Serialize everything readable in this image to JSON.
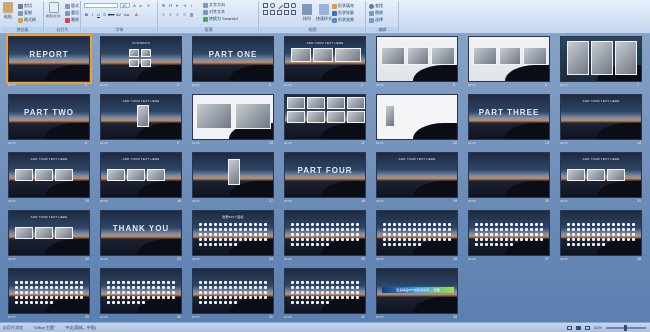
{
  "ribbon": {
    "groups": [
      {
        "label": "剪贴板"
      },
      {
        "label": "幻灯片"
      },
      {
        "label": "字体"
      },
      {
        "label": "段落"
      },
      {
        "label": "绘图"
      },
      {
        "label": "编辑"
      }
    ],
    "clipboard": {
      "paste": "粘贴",
      "cut": "剪切",
      "copy": "复制",
      "format_painter": "格式刷"
    },
    "slides": {
      "new_slide": "新建幻灯片",
      "layout": "版式",
      "reset": "重设",
      "delete": "删除"
    },
    "font": {
      "font_name": "",
      "font_size": "10"
    },
    "paragraph": {
      "text_direction": "文字方向",
      "align_text": "对齐文本",
      "convert_smartart": "转换为 SmartArt"
    },
    "drawing": {
      "arrange": "排列",
      "quick_styles": "快速样式",
      "shape_fill": "形状填充",
      "shape_outline": "形状轮廓",
      "shape_effects": "形状效果"
    },
    "editing": {
      "find": "查找",
      "replace": "替换",
      "select": "选择"
    }
  },
  "slides": [
    {
      "n": "1",
      "title": "",
      "big": "REPORT",
      "kind": "title"
    },
    {
      "n": "2",
      "title": "CONTENTS",
      "big": "",
      "kind": "contents"
    },
    {
      "n": "3",
      "title": "",
      "big": "PART ONE",
      "kind": "part"
    },
    {
      "n": "4",
      "title": "ADD YOUR TEXT HERE",
      "big": "",
      "kind": "photos"
    },
    {
      "n": "5",
      "title": "ADD YOUR TEXT HERE",
      "big": "",
      "kind": "photos-light"
    },
    {
      "n": "6",
      "title": "",
      "big": "",
      "kind": "photos-light"
    },
    {
      "n": "7",
      "title": "",
      "big": "",
      "kind": "photos-people"
    },
    {
      "n": "8",
      "title": "",
      "big": "PART TWO",
      "kind": "part"
    },
    {
      "n": "9",
      "title": "ADD YOUR TEXT HERE",
      "big": "",
      "kind": "phone"
    },
    {
      "n": "10",
      "title": "",
      "big": "",
      "kind": "photos-wide"
    },
    {
      "n": "11",
      "title": "",
      "big": "",
      "kind": "collage"
    },
    {
      "n": "12",
      "title": "App Project Sample",
      "big": "",
      "kind": "iphone"
    },
    {
      "n": "13",
      "title": "",
      "big": "PART THREE",
      "kind": "part"
    },
    {
      "n": "14",
      "title": "ADD YOUR TEXT HERE",
      "big": "",
      "kind": "circles"
    },
    {
      "n": "15",
      "title": "ADD YOUR TEXT HERE",
      "big": "",
      "kind": "photos-row"
    },
    {
      "n": "16",
      "title": "ADD YOUR TEXT HERE",
      "big": "",
      "kind": "photos-row"
    },
    {
      "n": "17",
      "title": "",
      "big": "",
      "kind": "iphone-center"
    },
    {
      "n": "18",
      "title": "",
      "big": "PART FOUR",
      "kind": "part"
    },
    {
      "n": "19",
      "title": "ADD YOUR TEXT HERE",
      "big": "",
      "kind": "diamonds"
    },
    {
      "n": "20",
      "title": "",
      "big": "",
      "kind": "ring"
    },
    {
      "n": "21",
      "title": "ADD YOUR TEXT HERE",
      "big": "",
      "kind": "photos-row"
    },
    {
      "n": "22",
      "title": "ADD YOUR TEXT HERE",
      "big": "",
      "kind": "photos-row"
    },
    {
      "n": "23",
      "title": "",
      "big": "THANK YOU",
      "kind": "title"
    },
    {
      "n": "24",
      "title": "附赠520个图标",
      "big": "",
      "kind": "icons"
    },
    {
      "n": "25",
      "title": "",
      "big": "",
      "kind": "icons"
    },
    {
      "n": "26",
      "title": "",
      "big": "",
      "kind": "icons"
    },
    {
      "n": "27",
      "title": "",
      "big": "",
      "kind": "icons"
    },
    {
      "n": "28",
      "title": "",
      "big": "",
      "kind": "icons"
    },
    {
      "n": "29",
      "title": "",
      "big": "",
      "kind": "icons"
    },
    {
      "n": "30",
      "title": "",
      "big": "",
      "kind": "icons"
    },
    {
      "n": "31",
      "title": "",
      "big": "",
      "kind": "icons"
    },
    {
      "n": "32",
      "title": "",
      "big": "",
      "kind": "icons"
    },
    {
      "n": "33",
      "title": "",
      "big": "",
      "kind": "banner",
      "banner_text": "更多精品PPT模板请访问 — 我图"
    }
  ],
  "slide_meta": "00:05",
  "status": {
    "view": "幻灯片浏览",
    "theme": "\"Office 主题\"",
    "language": "中文(简体，中国)",
    "zoom": "52%"
  }
}
